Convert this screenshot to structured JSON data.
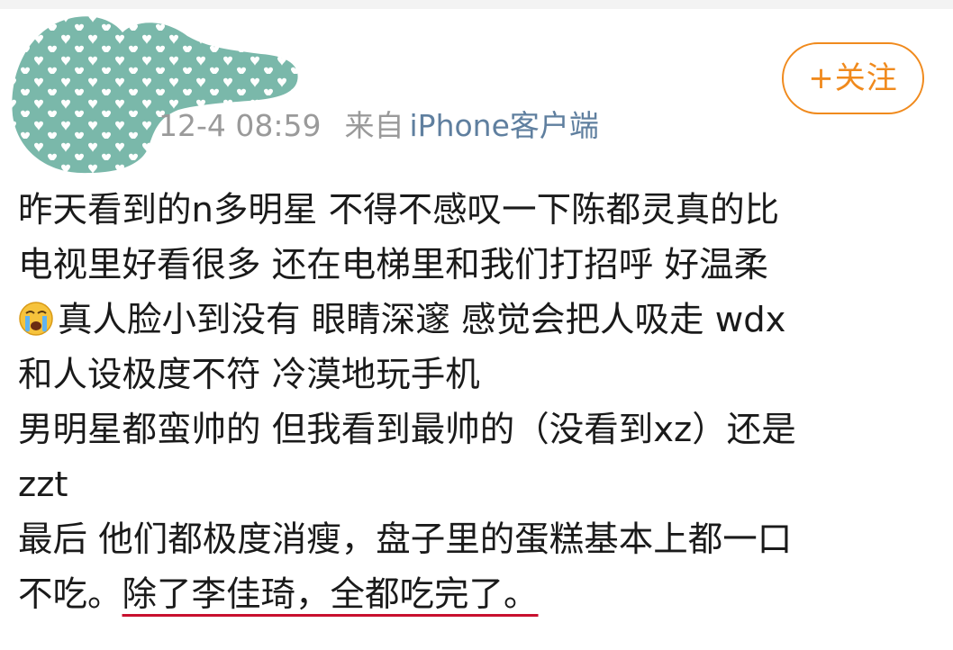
{
  "post": {
    "timestamp": "12-4 08:59",
    "from_label": "来自",
    "source": "iPhone客户端",
    "follow_button": "+关注",
    "emoji_icon": "crying-face-icon",
    "lines": [
      {
        "text": "昨天看到的n多明星 不得不感叹一下陈都灵真的比"
      },
      {
        "text": "电视里好看很多 还在电梯里和我们打招呼 好温柔"
      },
      {
        "text": "真人脸小到没有 眼睛深邃 感觉会把人吸走 wdx"
      },
      {
        "text": "和人设极度不符 冷漠地玩手机"
      },
      {
        "text": "男明星都蛮帅的 但我看到最帅的（没看到xz）还是"
      },
      {
        "text": "zzt"
      },
      {
        "text": "最后 他们都极度消瘦，盘子里的蛋糕基本上都一口"
      },
      {
        "text": "不吃。",
        "highlight": "除了李佳琦，全都吃完了。"
      }
    ]
  },
  "colors": {
    "accent_orange": "#f08a1d",
    "avatar_teal": "#7ab8aa",
    "underline_red": "#c8102e",
    "source_link": "#5f7f9f"
  }
}
